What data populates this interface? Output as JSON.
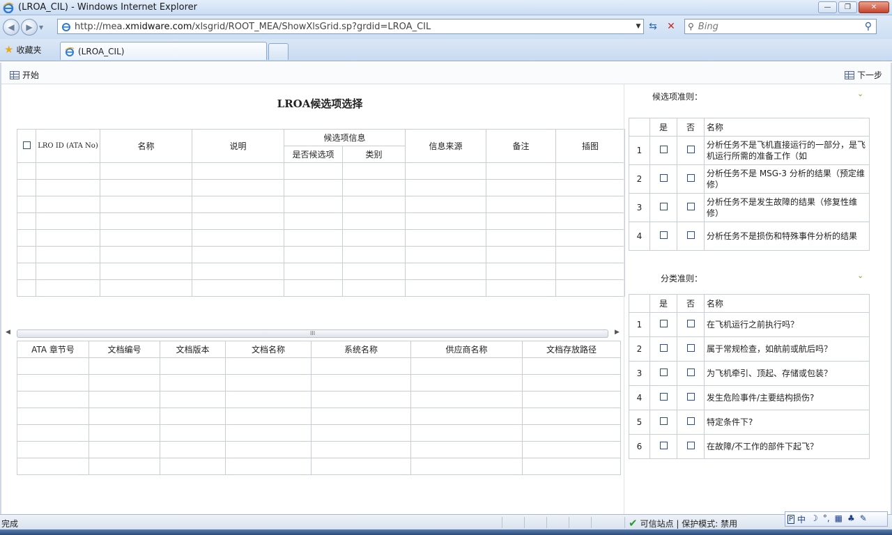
{
  "window": {
    "title": "(LROA_CIL) - Windows Internet Explorer",
    "minimize": "—",
    "maximize": "❐",
    "close": "✕"
  },
  "nav": {
    "back": "◀",
    "forward": "▶",
    "dropdown": "▼",
    "url_prefix": "http://mea.",
    "url_domain": "xmidware.com",
    "url_path": "/xlsgrid/ROOT_MEA/ShowXlsGrid.sp?grdid=LROA_CIL",
    "url_dd": "▼",
    "refresh": "⇆",
    "stop": "✕",
    "search_placeholder": "Bing",
    "search_icon": "⚲"
  },
  "favorites": {
    "star": "★",
    "label": "收藏夹"
  },
  "tab": {
    "label": "(LROA_CIL)"
  },
  "toolbar": {
    "start": "开始",
    "next": "下一步"
  },
  "main": {
    "title": "LROA候选项选择",
    "headers": {
      "id": "LRO ID (ATA No)",
      "name": "名称",
      "desc": "说明",
      "candidate_group": "候选项信息",
      "is_candidate": "是否候选项",
      "category": "类别",
      "source": "信息来源",
      "note": "备注",
      "figure": "插图"
    }
  },
  "scroll": {
    "left": "◀",
    "right": "▶",
    "grip": "III"
  },
  "docs": {
    "headers": [
      "ATA 章节号",
      "文档编号",
      "文档版本",
      "文档名称",
      "系统名称",
      "供应商名称",
      "文档存放路径"
    ]
  },
  "candidate_rules": {
    "title": "候选项准则：",
    "chevron": "⌄",
    "col_yes": "是",
    "col_no": "否",
    "col_name": "名称",
    "rows": [
      {
        "n": "1",
        "name": "分析任务不是飞机直接运行的一部分，是飞机运行所需的准备工作（如"
      },
      {
        "n": "2",
        "name": "分析任务不是 MSG-3 分析的结果（预定维修）"
      },
      {
        "n": "3",
        "name": "分析任务不是发生故障的结果（修复性维修）"
      },
      {
        "n": "4",
        "name": "分析任务不是损伤和特殊事件分析的结果"
      }
    ]
  },
  "class_rules": {
    "title": "分类准则：",
    "chevron": "⌄",
    "col_yes": "是",
    "col_no": "否",
    "col_name": "名称",
    "rows": [
      {
        "n": "1",
        "name": "在飞机运行之前执行吗？"
      },
      {
        "n": "2",
        "name": "属于常规检查，如航前或航后吗？"
      },
      {
        "n": "3",
        "name": "为飞机牵引、顶起、存储或包装？"
      },
      {
        "n": "4",
        "name": "发生危险事件/主要结构损伤?"
      },
      {
        "n": "5",
        "name": "特定条件下?"
      },
      {
        "n": "6",
        "name": "在故障/不工作的部件下起飞？"
      }
    ]
  },
  "status": {
    "text": "完成",
    "check": "✔",
    "zone": "可信站点 | 保护模式: 禁用"
  },
  "ime": {
    "items": [
      "中",
      "☽",
      "°,",
      "▦",
      "♣",
      "✎"
    ]
  },
  "colors": {
    "checkbox_border": "#2b4b8c",
    "grid_border": "#c8ced8"
  }
}
